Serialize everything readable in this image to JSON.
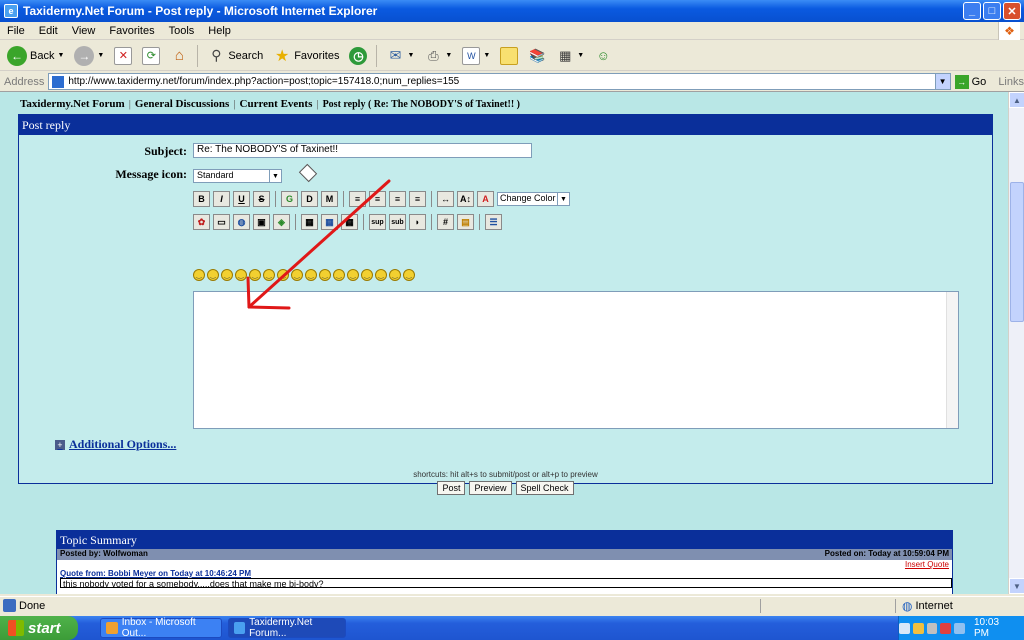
{
  "window": {
    "title": "Taxidermy.Net Forum - Post reply - Microsoft Internet Explorer"
  },
  "menu": [
    "File",
    "Edit",
    "View",
    "Favorites",
    "Tools",
    "Help"
  ],
  "toolbar": {
    "back": "Back",
    "search": "Search",
    "favorites": "Favorites"
  },
  "address": {
    "label": "Address",
    "url": "http://www.taxidermy.net/forum/index.php?action=post;topic=157418.0;num_replies=155",
    "go": "Go",
    "links": "Links"
  },
  "breadcrumbs": [
    "Taxidermy.Net Forum",
    "General Discussions",
    "Current Events",
    "Post reply ( Re: The NOBODY'S of Taxinet!! )"
  ],
  "post": {
    "header": "Post reply",
    "subject_label": "Subject:",
    "subject_value": "Re: The NOBODY'S of Taxinet!!",
    "icon_label": "Message icon:",
    "icon_value": "Standard",
    "change_color": "Change Color",
    "additional_options": "Additional Options...",
    "shortcuts": "shortcuts: hit alt+s to submit/post or alt+p to preview",
    "post_btn": "Post",
    "preview_btn": "Preview",
    "spell_btn": "Spell Check"
  },
  "format_buttons": [
    "B",
    "I",
    "U",
    "S",
    "G",
    "D",
    "M",
    "≡",
    "≡",
    "≡",
    "≡",
    "↔",
    "A↕",
    "A"
  ],
  "format_buttons2": [
    "✿",
    "▭",
    "◍",
    "▣",
    "◈",
    "▦",
    "▦",
    "▦",
    "sup",
    "sub",
    "◗",
    "#",
    "▤",
    "☰"
  ],
  "smiley_count": 16,
  "summary": {
    "header": "Topic Summary",
    "posted_by": "Posted by: Wolfwoman",
    "posted_on": "Posted on: Today at 10:59:04 PM",
    "insert_quote": "Insert Quote",
    "quote_from": "Quote from: Bobbi Meyer on Today at 10:46:24 PM",
    "quote_text": "this nobody voted for a somebody.....does that make me bi-body?"
  },
  "status": {
    "done": "Done",
    "zone": "Internet"
  },
  "taskbar": {
    "start": "start",
    "tasks": [
      "Inbox - Microsoft Out...",
      "Taxidermy.Net Forum..."
    ],
    "clock": "10:03 PM"
  }
}
